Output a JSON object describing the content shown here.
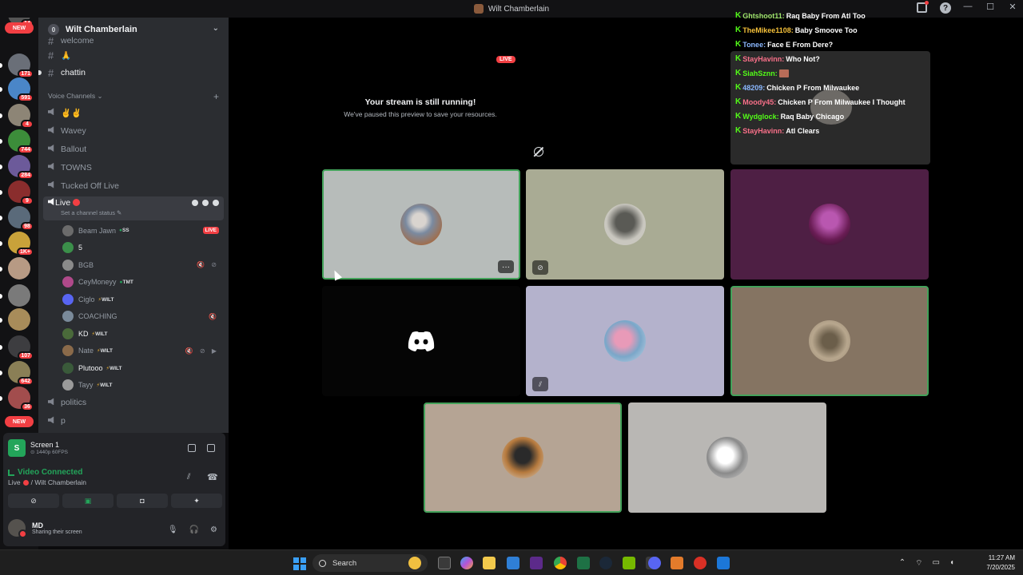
{
  "window": {
    "title": "Wilt Chamberlain"
  },
  "rail": {
    "top_badge": "14",
    "new_label_top": "NEW",
    "new_label_bottom": "NEW",
    "servers": [
      {
        "badge": "171",
        "color": "#6a6f78"
      },
      {
        "badge": "591",
        "color": "#4a86c8"
      },
      {
        "badge": "4",
        "color": "#8d8576"
      },
      {
        "badge": "744",
        "color": "#3c8d3a"
      },
      {
        "badge": "284",
        "color": "#6c5a9a"
      },
      {
        "badge": "9",
        "color": "#8a2d2d"
      },
      {
        "badge": "98",
        "color": "#5a6a7a"
      },
      {
        "badge": "1K+",
        "color": "#c9a23a"
      },
      {
        "badge": "",
        "color": "#b79a84"
      },
      {
        "badge": "",
        "color": "#7a7a7a"
      },
      {
        "badge": "",
        "color": "#a88c5a"
      },
      {
        "badge": "107",
        "color": "#3d3d40"
      },
      {
        "badge": "642",
        "color": "#8a7f56"
      },
      {
        "badge": "36",
        "color": "#a24d4d"
      }
    ]
  },
  "sidebar": {
    "server_name": "Wilt Chamberlain",
    "server_level": "0",
    "text_channels": [
      {
        "name": "welcome"
      },
      {
        "name": "🙏"
      },
      {
        "name": "chattin"
      }
    ],
    "voice_category": "Voice Channels",
    "voice_channels": [
      {
        "name": "✌️✌️"
      },
      {
        "name": "Wavey"
      },
      {
        "name": "Ballout"
      },
      {
        "name": "TOWNS"
      },
      {
        "name": "Tucked Off Live"
      }
    ],
    "live_channel": {
      "name": "Live",
      "status": "Set a channel status ✎"
    },
    "members": [
      {
        "name": "Beam Jawn",
        "tag": "SS",
        "tag_kind": "leaf",
        "live": "LIVE",
        "icons": "",
        "color": "#6b6b6b"
      },
      {
        "name": "5",
        "tag": "",
        "tag_kind": "",
        "live": "",
        "icons": "",
        "color": "#3b8f4a"
      },
      {
        "name": "BGB",
        "tag": "",
        "tag_kind": "",
        "live": "",
        "icons": "🔇 ⊘",
        "color": "#8a8a8a"
      },
      {
        "name": "CeyMoneyy",
        "tag": "TMT",
        "tag_kind": "leaf",
        "live": "",
        "icons": "",
        "color": "#b0498a"
      },
      {
        "name": "Ciglo",
        "tag": "WILT",
        "tag_kind": "bolt",
        "live": "",
        "icons": "",
        "color": "#5865f2"
      },
      {
        "name": "COACHING",
        "tag": "",
        "tag_kind": "",
        "live": "",
        "icons": "🔇",
        "color": "#7a8a9a"
      },
      {
        "name": "KD",
        "tag": "WILT",
        "tag_kind": "bolt",
        "live": "",
        "icons": "",
        "color": "#4a6a3a"
      },
      {
        "name": "Nate",
        "tag": "WILT",
        "tag_kind": "bolt",
        "live": "",
        "icons": "🔇 ⊘ ▶",
        "color": "#8a6a4a"
      },
      {
        "name": "Plutooo",
        "tag": "WILT",
        "tag_kind": "bolt",
        "live": "",
        "icons": "",
        "color": "#3a5a3a"
      },
      {
        "name": "Tayy",
        "tag": "WILT",
        "tag_kind": "bolt",
        "live": "",
        "icons": "",
        "color": "#9a9a9a"
      }
    ],
    "after_channels": [
      {
        "name": "politics"
      },
      {
        "name": "p"
      }
    ]
  },
  "panel": {
    "screen_title": "Screen 1",
    "screen_sub": "⊙ 1440p 60FPS",
    "video_status": "Video Connected",
    "location_channel": "Live",
    "location_server": "/ Wilt Chamberlain",
    "user_name": "MD",
    "user_status": "Sharing their screen"
  },
  "stage": {
    "live_pill": "LIVE",
    "paused_title": "Your stream is still running!",
    "paused_sub": "We've paused this preview to save your resources.",
    "more_label": "···"
  },
  "chat": {
    "messages": [
      {
        "user": "Ghtshoot11:",
        "text": "Raq Baby From Atl Too",
        "color": "green"
      },
      {
        "user": "TheMikee1108:",
        "text": "Baby Smoove Too",
        "color": "gold"
      },
      {
        "user": "Tonee:",
        "text": "Face E From Dere?",
        "color": "blue"
      },
      {
        "user": "StayHavinn:",
        "text": "Who Not?",
        "color": "pink"
      },
      {
        "user": "SiahSznn:",
        "text": "",
        "color": "green2"
      },
      {
        "user": "48209:",
        "text": "Chicken P From Milwaukee",
        "color": "blue"
      },
      {
        "user": "Moody45:",
        "text": "Chicken P From Milwaukee I Thought",
        "color": "pink"
      },
      {
        "user": "Wydglock:",
        "text": "Raq Baby Chicago",
        "color": "green2"
      },
      {
        "user": "StayHavinn:",
        "text": "Atl Clears",
        "color": "pink"
      }
    ]
  },
  "taskbar": {
    "search_label": "Search",
    "time": "11:27 AM",
    "date": "7/20/2025"
  },
  "colors": {
    "accent_green": "#23a55a",
    "danger_red": "#f23f43",
    "sidebar_bg": "#2b2d31",
    "stage_bg": "#000000"
  }
}
